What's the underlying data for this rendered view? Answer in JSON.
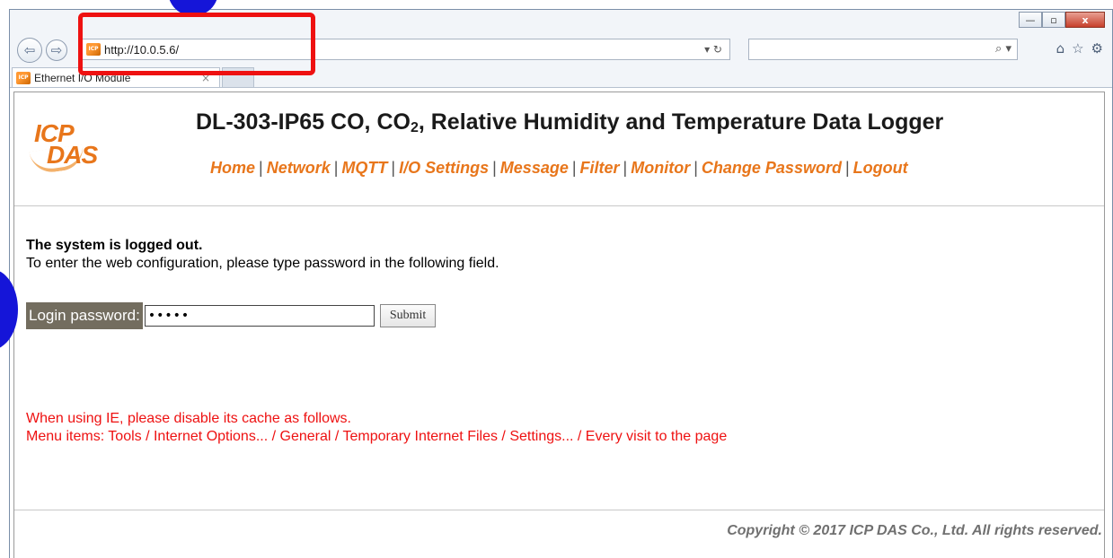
{
  "browser": {
    "url": "http://10.0.5.6/",
    "addr_tools": "▾ ↻",
    "tab_title": "Ethernet I/O Module",
    "tab_close": "×",
    "window_controls": [
      "—",
      "▫",
      "x"
    ],
    "nav_back": "⇦",
    "nav_forward": "⇨",
    "search_glyph": "⌕ ▾",
    "tool_icons": [
      "⌂",
      "☆",
      "⚙"
    ]
  },
  "page": {
    "logo_top": "ICP",
    "logo_bottom": "DAS",
    "title_pre": "DL-303-IP65 CO, CO",
    "title_sub": "2",
    "title_post": ", Relative Humidity and Temperature Data Logger",
    "menu": [
      "Home",
      "Network",
      "MQTT",
      "I/O Settings",
      "Message",
      "Filter",
      "Monitor",
      "Change Password",
      "Logout"
    ],
    "status": "The system is logged out.",
    "instruction": "To enter the web configuration, please type password in the following field.",
    "login_label": "Login password:",
    "password_value": "•••••",
    "submit_label": "Submit",
    "warning_line1": "When using IE, please disable its cache as follows.",
    "warning_line2": "Menu items: Tools / Internet Options... / General / Temporary Internet Files / Settings... / Every visit to the page",
    "copyright": "Copyright © 2017 ICP DAS Co., Ltd. All rights reserved."
  },
  "colors": {
    "accent": "#e8761b",
    "warning": "#ee1111",
    "label_bg": "#736d5f",
    "annotation_red": "#ee1111",
    "annotation_blue": "#1515d8"
  }
}
